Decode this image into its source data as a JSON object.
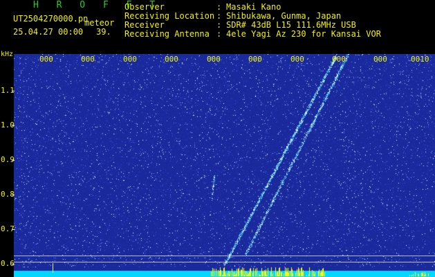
{
  "header": {
    "logo": "H R O F F T",
    "file_name": "UT2504270000.pn",
    "file_kind": "meteor",
    "date_time": "25.04.27 00:00",
    "count": "39.",
    "info": [
      {
        "key": "Observer",
        "sep": ":",
        "value": "Masaki Kano"
      },
      {
        "key": "Receiving Location",
        "sep": ":",
        "value": "Shibukawa, Gunma, Japan"
      },
      {
        "key": "Receiver",
        "sep": ":",
        "value": "SDR# 43dB L15 111.6MHz USB"
      },
      {
        "key": "Receiving Antenna",
        "sep": ":",
        "value": "4ele Yagi Az 230 for Kansai VOR"
      }
    ]
  },
  "axis": {
    "unit": "kHz",
    "yticks": [
      {
        "label": "1.1",
        "value": 1.1
      },
      {
        "label": "1.0",
        "value": 1.0
      },
      {
        "label": "0.9",
        "value": 0.9
      },
      {
        "label": "0.8",
        "value": 0.8
      },
      {
        "label": "0.7",
        "value": 0.7
      },
      {
        "label": "0.6",
        "value": 0.6
      }
    ],
    "xticks": [
      "000",
      "000",
      "000",
      "000",
      "000",
      "000",
      "000",
      "000",
      "000",
      "0010"
    ]
  },
  "colors": {
    "background": "#000000",
    "text": "#f2f200",
    "logo": "#1fd21f",
    "noise_base": "#1a2a9c",
    "signal": "#66e6ff",
    "amplitude_bar": "#00d8ff",
    "amplitude_peak": "#ffff00"
  }
}
